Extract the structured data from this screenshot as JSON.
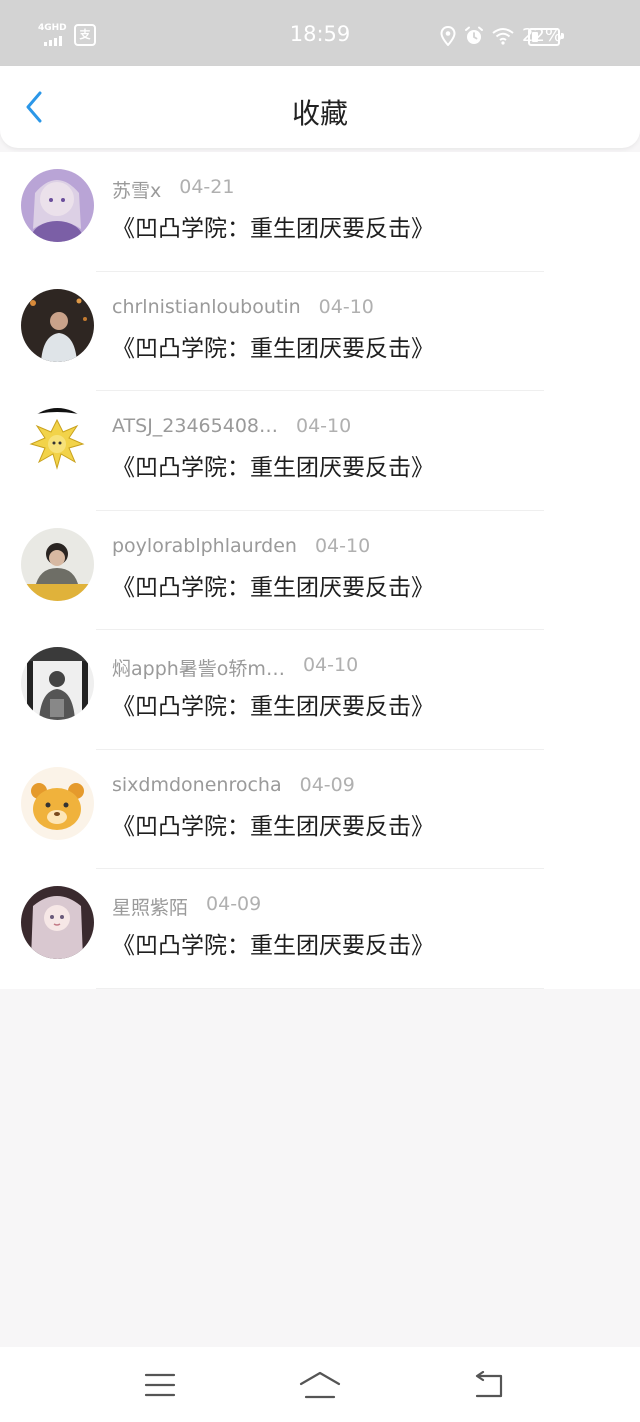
{
  "status_bar": {
    "network": "4GHD",
    "app_badge": "支",
    "time": "18:59",
    "battery_pct": "22%",
    "battery_level": 0.22
  },
  "header": {
    "title": "收藏"
  },
  "favorites": [
    {
      "user": "苏雪x",
      "date": "04-21",
      "work": "《凹凸学院：重生团厌要反击》",
      "avatar_color": "#b9a4d6"
    },
    {
      "user": "chrlnistianlouboutin",
      "date": "04-10",
      "work": "《凹凸学院：重生团厌要反击》",
      "avatar_color": "#2e2622"
    },
    {
      "user": "ATSJ_23465408…",
      "date": "04-10",
      "work": "《凹凸学院：重生团厌要反击》",
      "avatar_color": "#f2d34a"
    },
    {
      "user": "poylorablphlaurden",
      "date": "04-10",
      "work": "《凹凸学院：重生团厌要反击》",
      "avatar_color": "#8a8a7c"
    },
    {
      "user": "焖apph暑訾o轿m…",
      "date": "04-10",
      "work": "《凹凸学院：重生团厌要反击》",
      "avatar_color": "#5a5a5a"
    },
    {
      "user": "sixdmdonenrocha",
      "date": "04-09",
      "work": "《凹凸学院：重生团厌要反击》",
      "avatar_color": "#f0b23c"
    },
    {
      "user": "星照紫陌",
      "date": "04-09",
      "work": "《凹凸学院：重生团厌要反击》",
      "avatar_color": "#d9c8d0"
    }
  ],
  "colors": {
    "accent": "#2b97e8",
    "status_bar": "#d3d3d3",
    "page_bg": "#f7f6f7"
  }
}
